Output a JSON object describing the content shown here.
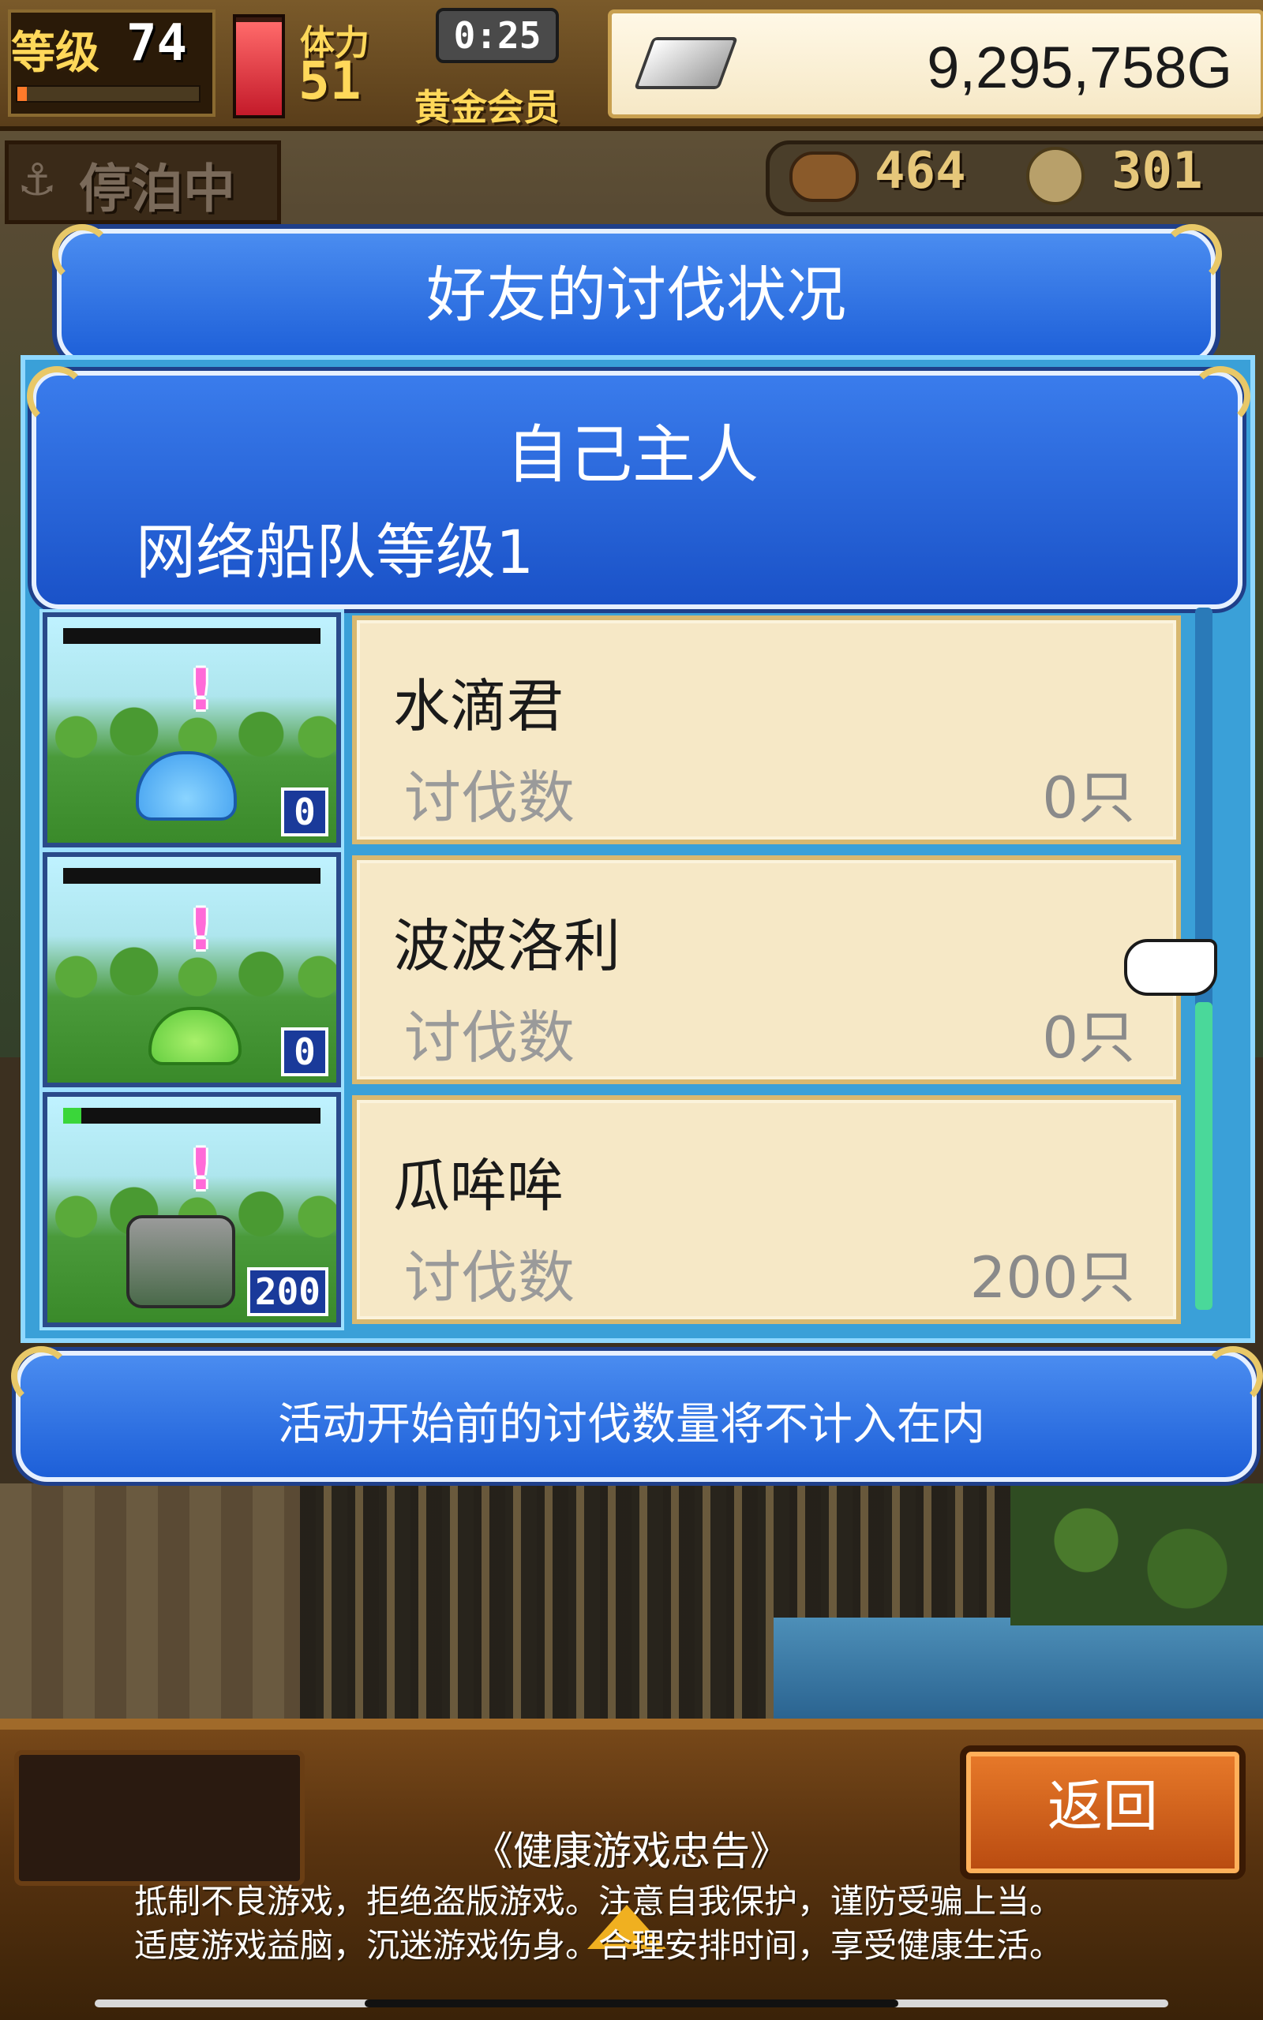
{
  "hud": {
    "level_label": "等级",
    "level_value": "74",
    "level_progress": 0.05,
    "stamina_label": "体力",
    "stamina_value": "51",
    "stamina_fill": 0.95,
    "timer": "0:25",
    "membership": "黄金会员",
    "gold_amount": "9,295,758G",
    "status": "停泊中",
    "food_amount": "464",
    "wood_amount": "301",
    "colors": {
      "accent_gold": "#ffd85a",
      "hud_brown": "#5a3e1a"
    }
  },
  "dialog": {
    "title": "好友的讨伐状况",
    "owner_name": "自己主人",
    "fleet_level": "网络船队等级1",
    "kill_label": "讨伐数",
    "rows": [
      {
        "name": "水滴君",
        "kills": "0只",
        "badge": "0",
        "hp": 0,
        "monster_icon": "water-drop-monster-icon"
      },
      {
        "name": "波波洛利",
        "kills": "0只",
        "badge": "0",
        "hp": 0,
        "monster_icon": "green-slime-monster-icon"
      },
      {
        "name": "瓜哞哞",
        "kills": "200只",
        "badge": "200",
        "hp": 0.07,
        "monster_icon": "armored-beast-monster-icon"
      }
    ],
    "notice": "活动开始前的讨伐数量将不计入在内",
    "colors": {
      "banner_blue": "#1d5fd8",
      "panel_blue": "#3aa0d8",
      "card_beige": "#f6e8c6"
    }
  },
  "bottom": {
    "back_label": "返回",
    "health_title": "《健康游戏忠告》",
    "health_line_1": "抵制不良游戏，拒绝盗版游戏。注意自我保护，谨防受骗上当。",
    "health_line_2": "适度游戏益脑，沉迷游戏伤身。合理安排时间，享受健康生活。"
  }
}
